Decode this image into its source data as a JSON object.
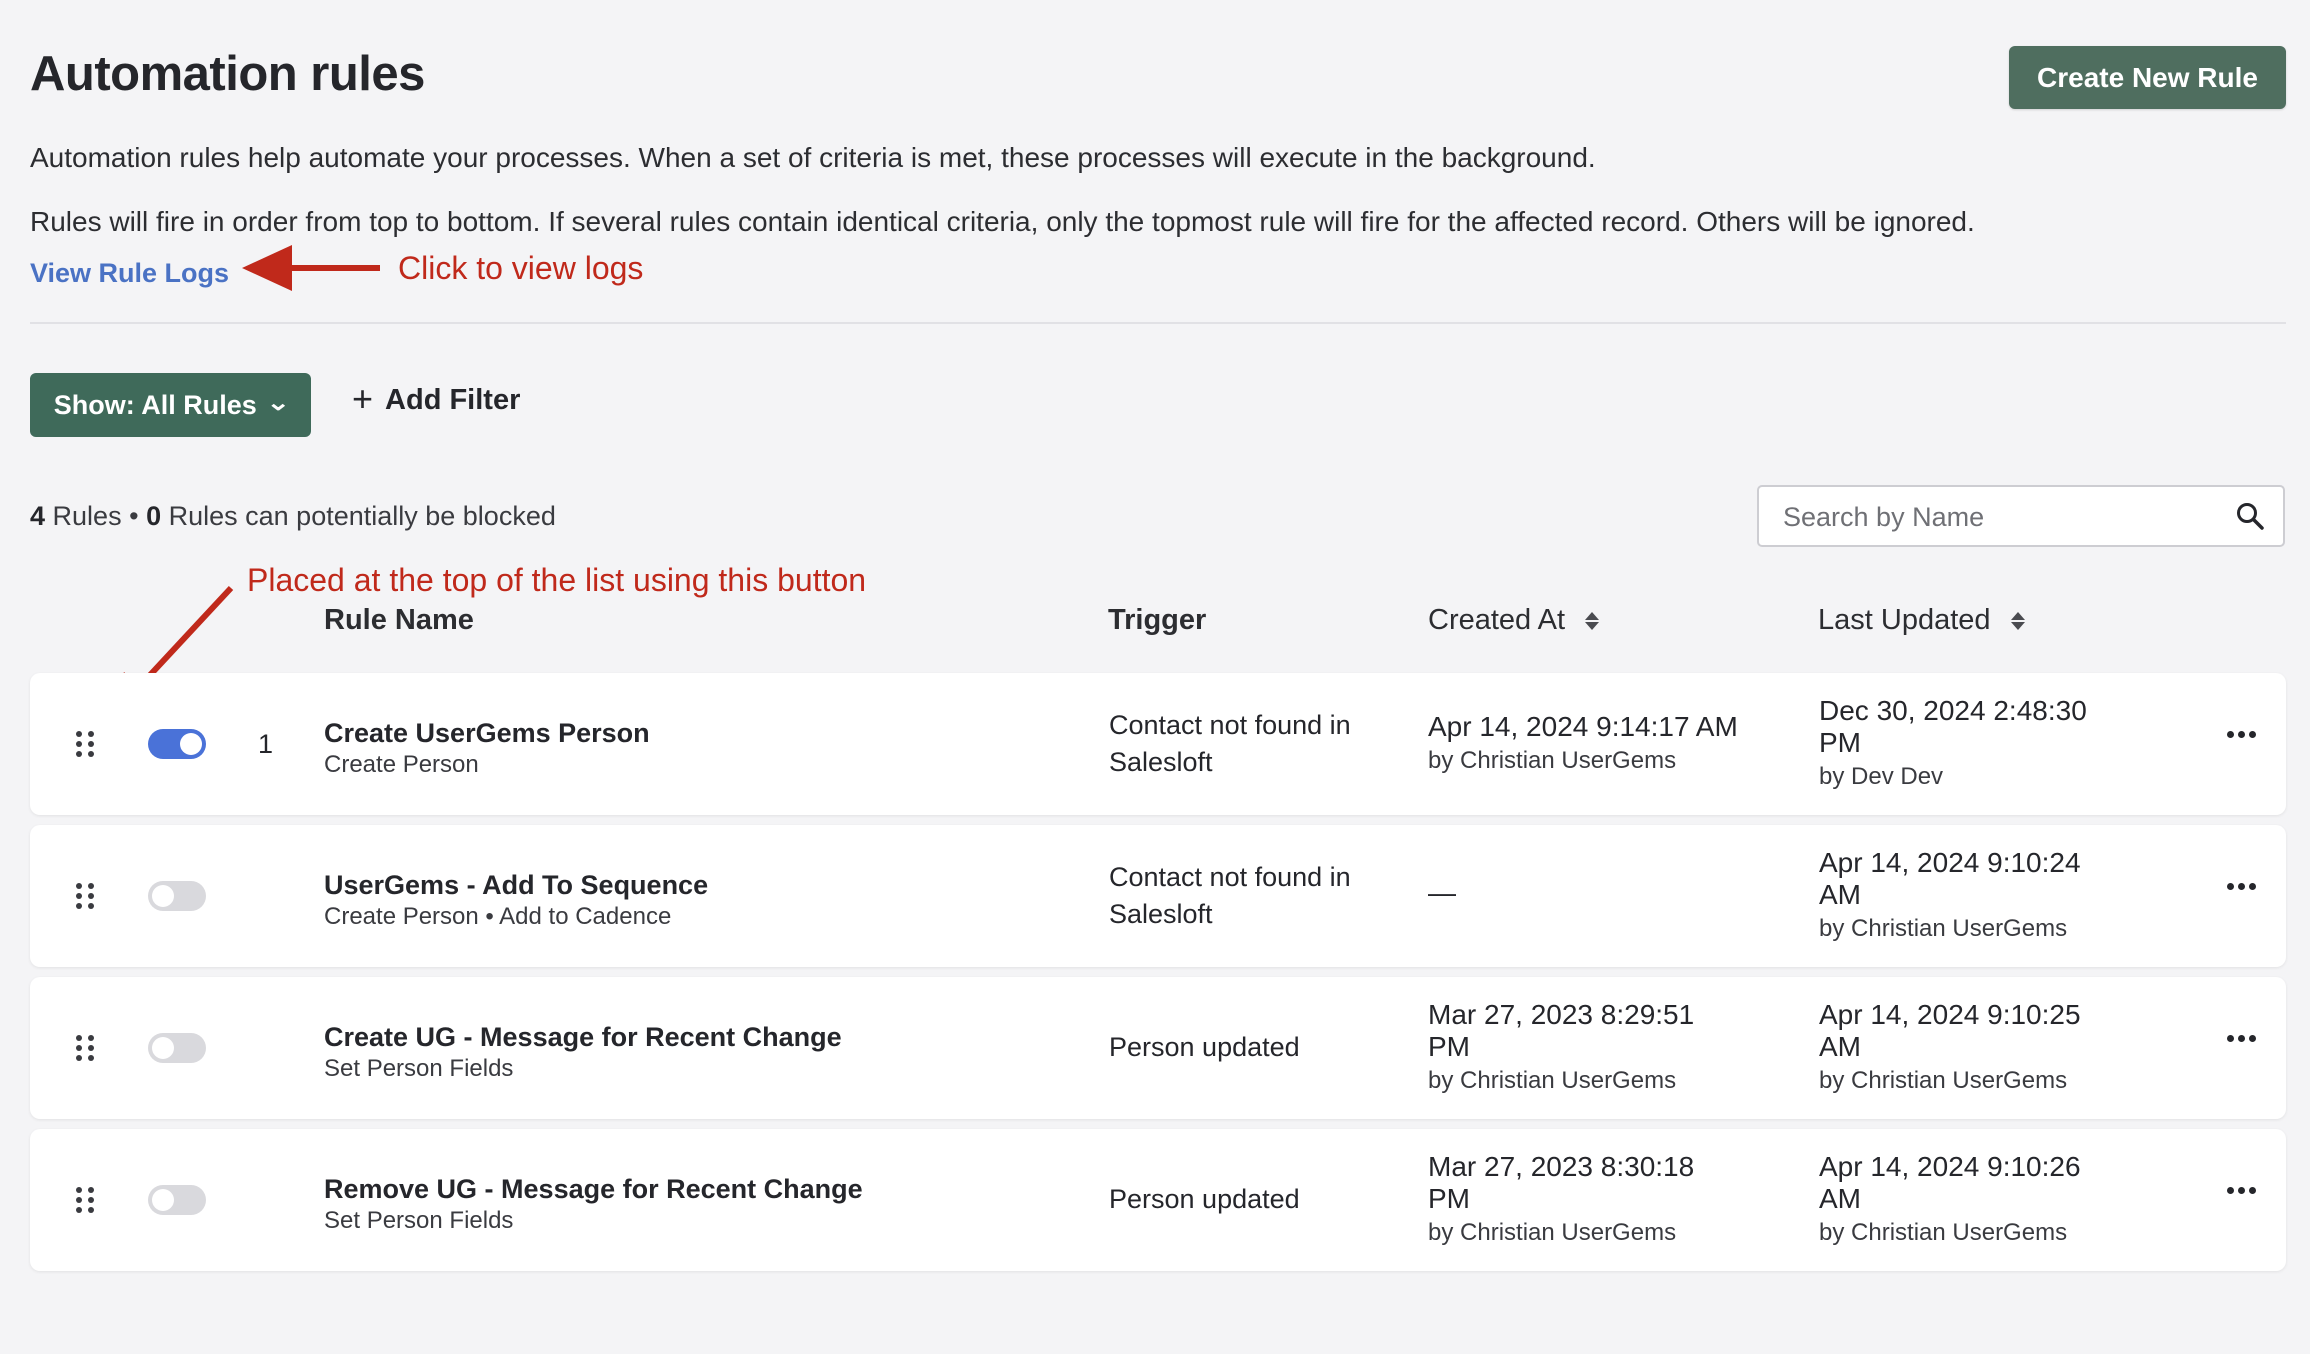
{
  "header": {
    "title": "Automation rules",
    "create_button": "Create New Rule"
  },
  "description": {
    "line1": "Automation rules help automate your processes. When a set of criteria is met, these processes will execute in the background.",
    "line2": "Rules will fire in order from top to bottom. If several rules contain identical criteria, only the topmost rule will fire for the affected record. Others will be ignored.",
    "logs_link": "View Rule Logs"
  },
  "annotations": {
    "logs": "Click to view logs",
    "top": "Placed at the top of the list using this button"
  },
  "toolbar": {
    "show_label": "Show: All Rules",
    "add_filter_label": "Add Filter"
  },
  "summary": {
    "rules_count": "4",
    "rules_word": "Rules",
    "blocked_count": "0",
    "blocked_text": "Rules can potentially be blocked"
  },
  "search": {
    "placeholder": "Search by Name"
  },
  "columns": {
    "rule_name": "Rule Name",
    "trigger": "Trigger",
    "created_at": "Created At",
    "last_updated": "Last Updated"
  },
  "rules": [
    {
      "enabled": true,
      "order": "1",
      "name": "Create UserGems Person",
      "actions": "Create Person",
      "trigger_line1": "Contact not found in",
      "trigger_line2": "Salesloft",
      "created_line1": "Apr 14, 2024 9:14:17 AM",
      "created_line2": "",
      "created_by": "by Christian UserGems",
      "updated_line1": "Dec 30, 2024 2:48:30",
      "updated_line2": "PM",
      "updated_by": "by Dev Dev"
    },
    {
      "enabled": false,
      "order": "",
      "name": "UserGems - Add To Sequence",
      "actions": "Create Person • Add to Cadence",
      "trigger_line1": "Contact not found in",
      "trigger_line2": "Salesloft",
      "created_line1": "—",
      "created_line2": "",
      "created_by": "",
      "updated_line1": "Apr 14, 2024 9:10:24",
      "updated_line2": "AM",
      "updated_by": "by Christian UserGems"
    },
    {
      "enabled": false,
      "order": "",
      "name": "Create UG - Message for Recent Change",
      "actions": "Set Person Fields",
      "trigger_line1": "Person updated",
      "trigger_line2": "",
      "created_line1": "Mar 27, 2023 8:29:51",
      "created_line2": "PM",
      "created_by": "by Christian UserGems",
      "updated_line1": "Apr 14, 2024 9:10:25",
      "updated_line2": "AM",
      "updated_by": "by Christian UserGems"
    },
    {
      "enabled": false,
      "order": "",
      "name": "Remove UG - Message for Recent Change",
      "actions": "Set Person Fields",
      "trigger_line1": "Person updated",
      "trigger_line2": "",
      "created_line1": "Mar 27, 2023 8:30:18",
      "created_line2": "PM",
      "created_by": "by Christian UserGems",
      "updated_line1": "Apr 14, 2024 9:10:26",
      "updated_line2": "AM",
      "updated_by": "by Christian UserGems"
    }
  ],
  "colors": {
    "primary_green": "#4f6e5f",
    "show_green": "#3f6a5a",
    "link_blue": "#4a72c4",
    "toggle_on": "#4a72d8",
    "annotation_red": "#c0291b"
  }
}
